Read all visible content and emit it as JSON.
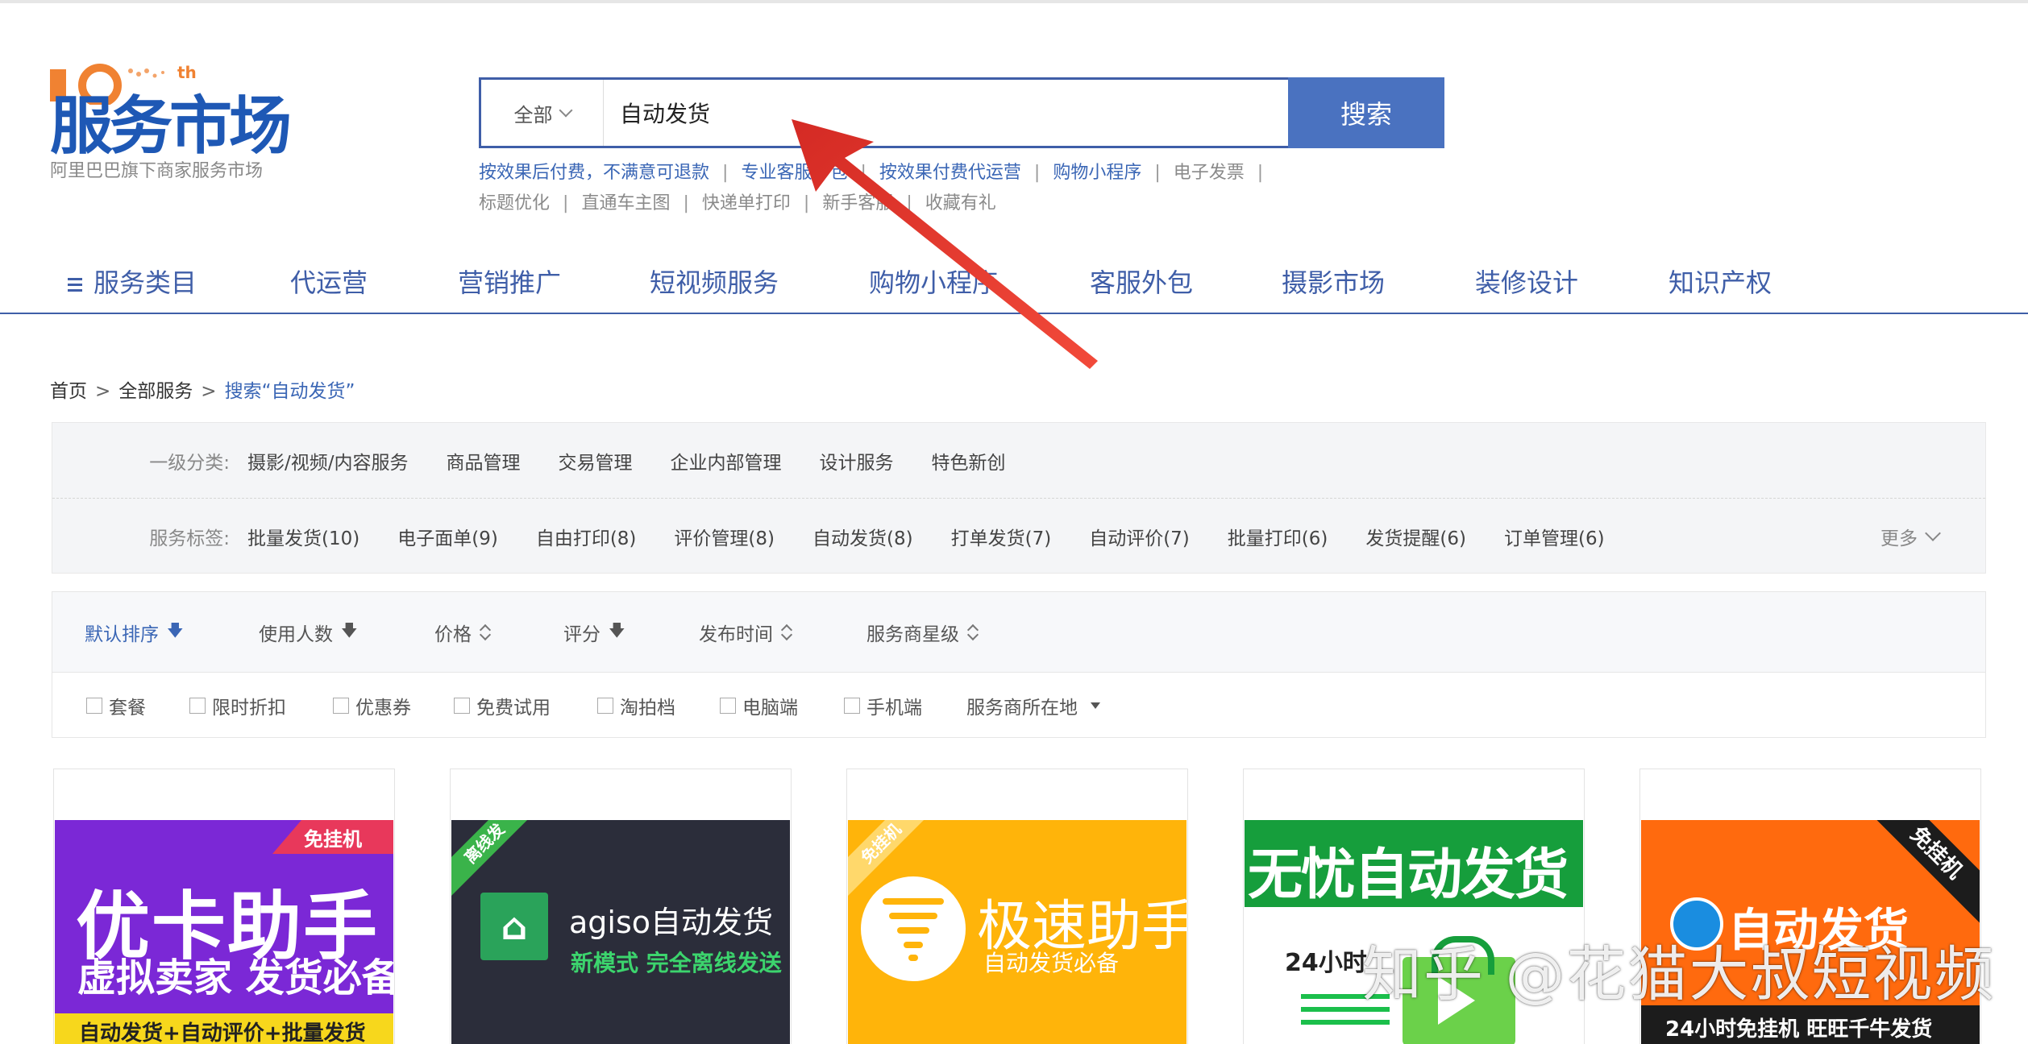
{
  "logo": {
    "name": "服务市场",
    "tenth": "th",
    "subtitle": "阿里巴巴旗下商家服务市场"
  },
  "search": {
    "scope": "全部",
    "value": "自动发货",
    "button": "搜索"
  },
  "hotlinks": {
    "row1": [
      "按效果后付费，不满意可退款",
      "专业客服外包",
      "按效果付费代运营",
      "购物小程序",
      "电子发票"
    ],
    "row2": [
      "标题优化",
      "直通车主图",
      "快递单打印",
      "新手客服",
      "收藏有礼"
    ]
  },
  "nav": [
    "服务类目",
    "代运营",
    "营销推广",
    "短视频服务",
    "购物小程序",
    "客服外包",
    "摄影市场",
    "装修设计",
    "知识产权"
  ],
  "breadcrumb": {
    "home": "首页",
    "all": "全部服务",
    "current": "搜索“自动发货”"
  },
  "filters": {
    "category_label": "一级分类:",
    "categories": [
      "摄影/视频/内容服务",
      "商品管理",
      "交易管理",
      "企业内部管理",
      "设计服务",
      "特色新创"
    ],
    "tag_label": "服务标签:",
    "tags": [
      "批量发货(10)",
      "电子面单(9)",
      "自由打印(8)",
      "评价管理(8)",
      "自动发货(8)",
      "打单发货(7)",
      "自动评价(7)",
      "批量打印(6)",
      "发货提醒(6)",
      "订单管理(6)"
    ],
    "more": "更多"
  },
  "sort": [
    "默认排序",
    "使用人数",
    "价格",
    "评分",
    "发布时间",
    "服务商星级"
  ],
  "checkboxes": [
    "套餐",
    "限时折扣",
    "优惠券",
    "免费试用",
    "淘拍档",
    "电脑端",
    "手机端"
  ],
  "location_filter": "服务商所在地",
  "cards": [
    {
      "tag": "免挂机",
      "title": "优卡助手",
      "subtitle": "虚拟卖家 发货必备",
      "footer": "自动发货+自动评价+批量发货"
    },
    {
      "ribbon": "离线发",
      "title": "agiso自动发货",
      "subtitle": "新模式 完全离线发送"
    },
    {
      "ribbon": "免挂机",
      "title": "极速助手",
      "subtitle": "自动发货必备"
    },
    {
      "title": "无忧自动发货",
      "subtitle": "24小时"
    },
    {
      "tag": "免挂机",
      "title": "自动发货",
      "footer": "24小时免挂机 旺旺千牛发货"
    }
  ],
  "watermark": "知乎 @花猫大叔短视频",
  "colors": {
    "brand": "#3f5ea8",
    "search_button": "#4a72c0",
    "link": "#3a66b5",
    "annotation_arrow": "#e8332a"
  }
}
